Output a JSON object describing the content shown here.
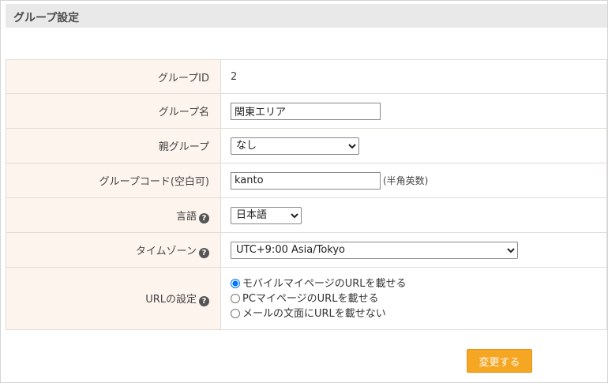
{
  "header": {
    "title": "グループ設定"
  },
  "form": {
    "group_id": {
      "label": "グループID",
      "value": "2"
    },
    "group_name": {
      "label": "グループ名",
      "value": "関東エリア"
    },
    "parent_group": {
      "label": "親グループ",
      "selected": "なし"
    },
    "group_code": {
      "label": "グループコード(空白可)",
      "value": "kanto",
      "hint": "(半角英数)"
    },
    "language": {
      "label": "言語",
      "selected": "日本語"
    },
    "timezone": {
      "label": "タイムゾーン",
      "selected": "UTC+9:00 Asia/Tokyo"
    },
    "url_setting": {
      "label": "URLの設定",
      "options": [
        {
          "label": "モバイルマイページのURLを載せる",
          "checked": true
        },
        {
          "label": "PCマイページのURLを載せる",
          "checked": false
        },
        {
          "label": "メールの文面にURLを載せない",
          "checked": false
        }
      ]
    }
  },
  "actions": {
    "submit_label": "変更する"
  },
  "icons": {
    "help": "question-circle-icon"
  },
  "colors": {
    "accent": "#f5a623",
    "label_bg": "#fdf4ee",
    "header_bg": "#e9e9e9"
  }
}
